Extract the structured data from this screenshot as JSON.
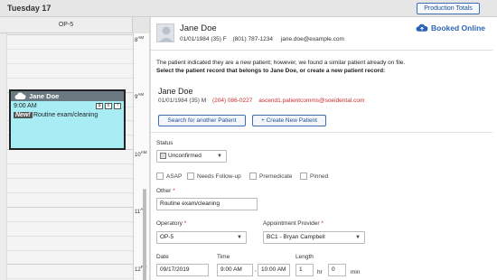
{
  "header": {
    "day_title": "Tuesday 17",
    "production_totals": "Production Totals"
  },
  "calendar": {
    "operatory": "OP-5",
    "times": [
      {
        "hour": "8",
        "ampm": "AM"
      },
      {
        "hour": "9",
        "ampm": "AM"
      },
      {
        "hour": "10",
        "ampm": "AM"
      },
      {
        "hour": "11",
        "ampm": "AM"
      },
      {
        "hour": "12",
        "ampm": "PM"
      }
    ],
    "appointment": {
      "patient": "Jane Doe",
      "time": "9:00 AM",
      "new_badge": "New!",
      "procedure": "Routine exam/cleaning"
    }
  },
  "patient": {
    "name": "Jane Doe",
    "dob": "01/01/1984 (35) F",
    "phone": "(801) 787-1234",
    "email": "jane.doe@example.com",
    "booked": "Booked Online"
  },
  "notice": {
    "line1": "The patient indicated they are a new patient; however, we found a similar patient already on file.",
    "line2": "Select the patient record that belongs to Jane Doe, or create a new patient record:"
  },
  "similar": {
    "name": "Jane Doe",
    "dob": "01/01/1984 (35) M",
    "phone": "(204) 086-0227",
    "email": "ascend1.patientcomms@soeidental.com",
    "search_btn": "Search for another Patient",
    "create_btn": "+ Create New Patient"
  },
  "form": {
    "status_label": "Status",
    "status_value": "Unconfirmed",
    "checkboxes": [
      "ASAP",
      "Needs Follow-up",
      "Premedicate",
      "Pinned"
    ],
    "other_label": "Other",
    "other_value": "Routine exam/cleaning",
    "operatory_label": "Operatory",
    "operatory_value": "OP-5",
    "provider_label": "Appointment Provider",
    "provider_value": "BC1 - Bryan Campbell",
    "date_label": "Date",
    "date_value": "09/17/2019",
    "time_label": "Time",
    "time_start": "9:00 AM",
    "time_end": "10:00 AM",
    "length_label": "Length",
    "length_hr": "1",
    "hr_unit": "hr",
    "length_min": "0",
    "min_unit": "min"
  },
  "colors": {
    "accent": "#2b64b4",
    "appointment_bg": "#a8ecf4",
    "required": "#cc2b2b"
  }
}
